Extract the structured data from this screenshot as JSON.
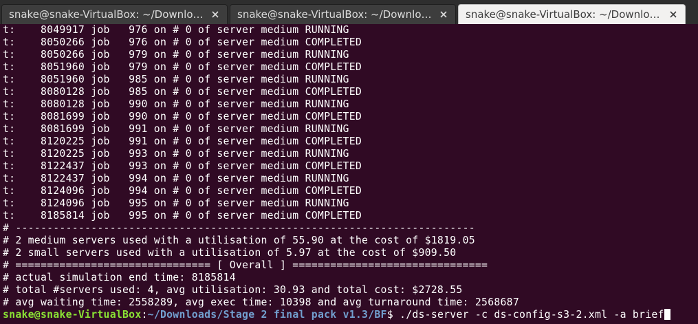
{
  "tabs": [
    {
      "title": "snake@snake-VirtualBox: ~/Downloads/...",
      "active": false
    },
    {
      "title": "snake@snake-VirtualBox: ~/Downloads/...",
      "active": false
    },
    {
      "title": "snake@snake-VirtualBox: ~/Downloads/S...",
      "active": true
    }
  ],
  "icons": {
    "tab_close": "close-icon"
  },
  "colors": {
    "background": "#300a24",
    "prompt_user": "#8ae234",
    "prompt_path": "#729fcf",
    "text": "#ffffff"
  },
  "output_lines": [
    "t:    8049917 job   976 on # 0 of server medium RUNNING",
    "t:    8050266 job   976 on # 0 of server medium COMPLETED",
    "t:    8050266 job   979 on # 0 of server medium RUNNING",
    "t:    8051960 job   979 on # 0 of server medium COMPLETED",
    "t:    8051960 job   985 on # 0 of server medium RUNNING",
    "t:    8080128 job   985 on # 0 of server medium COMPLETED",
    "t:    8080128 job   990 on # 0 of server medium RUNNING",
    "t:    8081699 job   990 on # 0 of server medium COMPLETED",
    "t:    8081699 job   991 on # 0 of server medium RUNNING",
    "t:    8120225 job   991 on # 0 of server medium COMPLETED",
    "t:    8120225 job   993 on # 0 of server medium RUNNING",
    "t:    8122437 job   993 on # 0 of server medium COMPLETED",
    "t:    8122437 job   994 on # 0 of server medium RUNNING",
    "t:    8124096 job   994 on # 0 of server medium COMPLETED",
    "t:    8124096 job   995 on # 0 of server medium RUNNING",
    "t:    8185814 job   995 on # 0 of server medium COMPLETED",
    "# -------------------------------------------------------------------------",
    "# 2 medium servers used with a utilisation of 55.90 at the cost of $1819.05",
    "# 2 small servers used with a utilisation of 5.97 at the cost of $909.50",
    "# =============================== [ Overall ] ===============================",
    "# actual simulation end time: 8185814",
    "# total #servers used: 4, avg utilisation: 30.93 and total cost: $2728.55",
    "# avg waiting time: 2558289, avg exec time: 10398 and avg turnaround time: 2568687"
  ],
  "prompt": {
    "user_host": "snake@snake-VirtualBox",
    "separator": ":",
    "path": "~/Downloads/Stage 2 final pack v1.3/BF",
    "symbol": "$ ",
    "command": "./ds-server -c ds-config-s3-2.xml -a brief"
  }
}
